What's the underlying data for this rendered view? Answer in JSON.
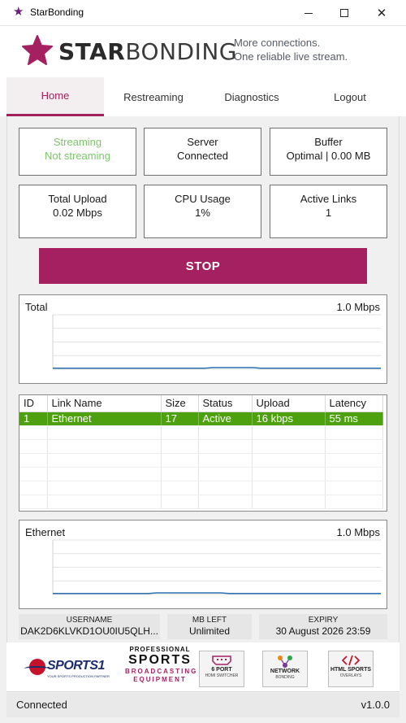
{
  "window": {
    "title": "StarBonding",
    "min_glyph": "–",
    "max_glyph": "☐",
    "close_glyph": "✕"
  },
  "brand": {
    "name_bold": "STAR",
    "name_rest": "BONDING",
    "tagline_line1": "More connections.",
    "tagline_line2": "One reliable live stream.",
    "color": "#a42061"
  },
  "tabs": [
    {
      "label": "Home",
      "active": true
    },
    {
      "label": "Restreaming",
      "active": false
    },
    {
      "label": "Diagnostics",
      "active": false
    },
    {
      "label": "Logout",
      "active": false
    }
  ],
  "stats": {
    "streaming": {
      "label": "Streaming",
      "value": "Not streaming",
      "color": "#7dc46b"
    },
    "server": {
      "label": "Server",
      "value": "Connected"
    },
    "buffer": {
      "label": "Buffer",
      "value": "Optimal | 0.00 MB"
    },
    "total_upload": {
      "label": "Total Upload",
      "value": "0.02 Mbps"
    },
    "cpu": {
      "label": "CPU Usage",
      "value": "1%"
    },
    "active_links": {
      "label": "Active Links",
      "value": "1"
    }
  },
  "stop_button": {
    "label": "STOP",
    "color": "#a42061"
  },
  "total_graph": {
    "title": "Total",
    "scale": "1.0 Mbps",
    "ymax": 1.0,
    "values": [
      0.02,
      0.02,
      0.02,
      0.02,
      0.02,
      0.02,
      0.02,
      0.02,
      0.02,
      0.02,
      0.02,
      0.02,
      0.02,
      0.02,
      0.02,
      0.02,
      0.02,
      0.02,
      0.02,
      0.02,
      0.03,
      0.03,
      0.03,
      0.03,
      0.03,
      0.03,
      0.02,
      0.02,
      0.02,
      0.02,
      0.02,
      0.02,
      0.02,
      0.02,
      0.02,
      0.02,
      0.02,
      0.02,
      0.02,
      0.02,
      0.02,
      0.02
    ]
  },
  "links_table": {
    "columns": [
      "ID",
      "Link Name",
      "Size",
      "Status",
      "Upload",
      "Latency"
    ],
    "rows": [
      {
        "id": "1",
        "name": "Ethernet",
        "size": "17",
        "status": "Active",
        "upload": "16 kbps",
        "latency": "55 ms"
      }
    ],
    "selected_color": "#4ea10e"
  },
  "ethernet_graph": {
    "title": "Ethernet",
    "scale": "1.0 Mbps",
    "ymax": 1.0,
    "values": [
      0.02,
      0.02,
      0.02,
      0.02,
      0.02,
      0.02,
      0.02,
      0.02,
      0.02,
      0.02,
      0.02,
      0.02,
      0.02,
      0.03,
      0.03,
      0.03,
      0.03,
      0.03,
      0.03,
      0.03,
      0.03,
      0.03,
      0.02,
      0.02,
      0.02,
      0.02,
      0.02,
      0.02,
      0.02,
      0.02,
      0.02,
      0.02,
      0.02,
      0.02,
      0.02,
      0.02,
      0.02,
      0.02,
      0.02,
      0.02,
      0.02,
      0.02
    ]
  },
  "account": {
    "username_label": "USERNAME",
    "username": "DAK2D6KLVKD1OU0IU5QLH...",
    "mb_left_label": "MB LEFT",
    "mb_left": "Unlimited",
    "expiry_label": "EXPIRY",
    "expiry": "30 August 2026 23:59"
  },
  "partners": {
    "sports1_word": "SPORTS1",
    "sports1_tag": "YOUR SPORTS PRODUCTION PARTNER",
    "pro_line1": "PROFESSIONAL",
    "pro_line2": "SPORTS",
    "pro_line3": "BROADCASTING",
    "pro_line4": "EQUIPMENT",
    "badge1_title": "6 PORT",
    "badge1_sub": "HDMI SWITCHER",
    "badge2_title": "NETWORK",
    "badge2_sub": "BONDING",
    "badge3_title": "HTML SPORTS",
    "badge3_sub": "OVERLAYS"
  },
  "statusbar": {
    "status": "Connected",
    "version": "v1.0.0"
  }
}
